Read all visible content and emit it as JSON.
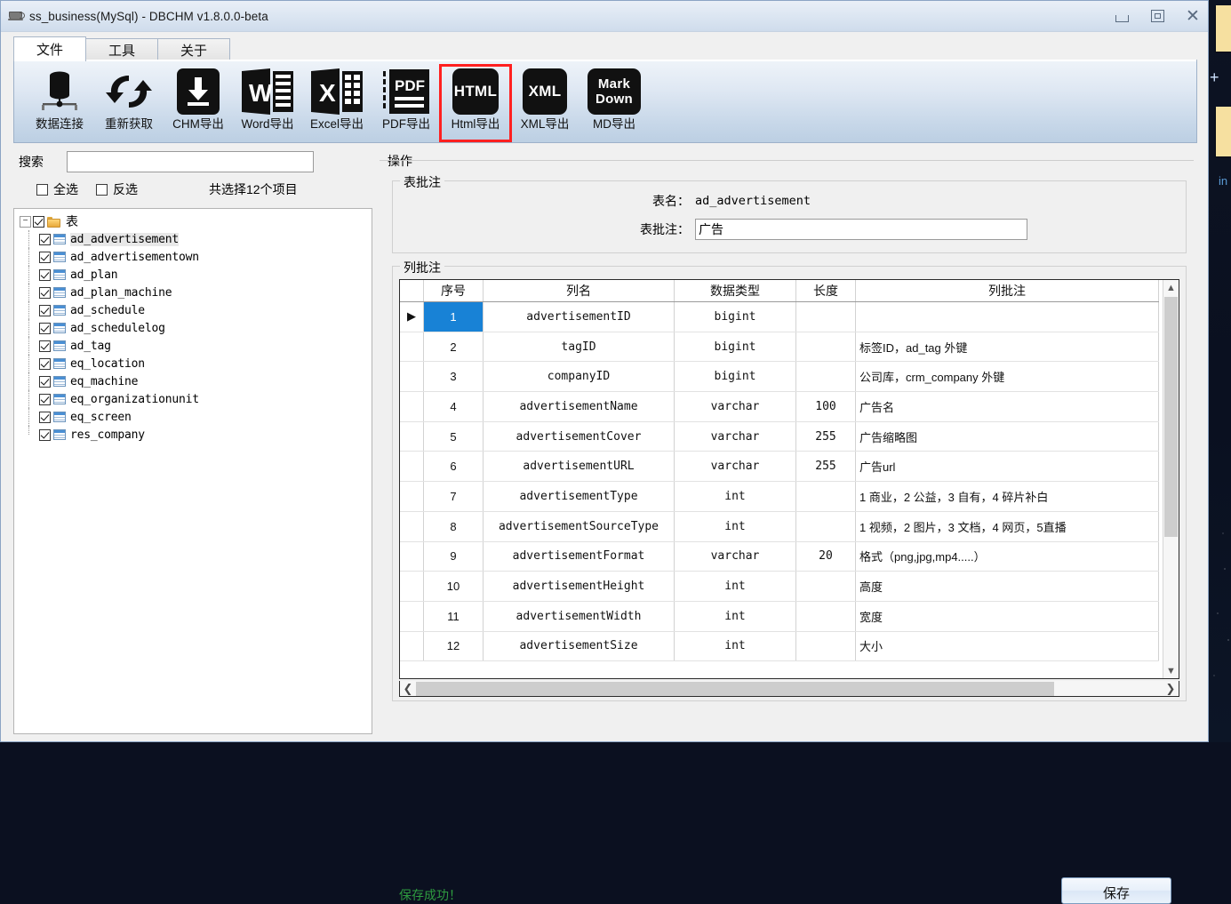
{
  "window": {
    "title": "ss_business(MySql) - DBCHM v1.8.0.0-beta",
    "icon": "database-cup-icon",
    "minimize": "—",
    "maximize": "□",
    "close": "✕"
  },
  "tabs": [
    {
      "label": "文件",
      "active": true
    },
    {
      "label": "工具",
      "active": false
    },
    {
      "label": "关于",
      "active": false
    }
  ],
  "toolbar": {
    "selected": "Html导出",
    "highlight_color": "#ff2020",
    "items": [
      {
        "label": "数据连接",
        "icon": "database-icon",
        "glyph": ""
      },
      {
        "label": "重新获取",
        "icon": "refresh-icon",
        "glyph": ""
      },
      {
        "label": "CHM导出",
        "icon": "chm-download-icon",
        "glyph": ""
      },
      {
        "label": "Word导出",
        "icon": "word-icon",
        "glyph": "W"
      },
      {
        "label": "Excel导出",
        "icon": "excel-icon",
        "glyph": "X"
      },
      {
        "label": "PDF导出",
        "icon": "pdf-icon",
        "glyph": "PDF"
      },
      {
        "label": "Html导出",
        "icon": "html-icon",
        "glyph": "HTML"
      },
      {
        "label": "XML导出",
        "icon": "xml-icon",
        "glyph": "XML"
      },
      {
        "label": "MD导出",
        "icon": "markdown-icon",
        "glyph": "Mark Down"
      }
    ]
  },
  "sidebar": {
    "search_label": "搜索",
    "search_value": "",
    "search_placeholder": "",
    "select_all_label": "全选",
    "select_all_checked": false,
    "invert_label": "反选",
    "invert_checked": false,
    "selected_count_text": "共选择12个项目",
    "root": {
      "label": "表",
      "checked": true,
      "expanded": true
    },
    "tables": [
      {
        "name": "ad_advertisement",
        "checked": true,
        "selected": true
      },
      {
        "name": "ad_advertisementown",
        "checked": true,
        "selected": false
      },
      {
        "name": "ad_plan",
        "checked": true,
        "selected": false
      },
      {
        "name": "ad_plan_machine",
        "checked": true,
        "selected": false
      },
      {
        "name": "ad_schedule",
        "checked": true,
        "selected": false
      },
      {
        "name": "ad_schedulelog",
        "checked": true,
        "selected": false
      },
      {
        "name": "ad_tag",
        "checked": true,
        "selected": false
      },
      {
        "name": "eq_location",
        "checked": true,
        "selected": false
      },
      {
        "name": "eq_machine",
        "checked": true,
        "selected": false
      },
      {
        "name": "eq_organizationunit",
        "checked": true,
        "selected": false
      },
      {
        "name": "eq_screen",
        "checked": true,
        "selected": false
      },
      {
        "name": "res_company",
        "checked": true,
        "selected": false
      }
    ]
  },
  "main": {
    "operations_title": "操作",
    "table_comment_group": {
      "legend": "表批注",
      "table_name_label": "表名：",
      "table_name_value": "ad_advertisement",
      "comment_label": "表批注：",
      "comment_value": "广告"
    },
    "column_comment_group": {
      "legend": "列批注",
      "headers": [
        "",
        "序号",
        "列名",
        "数据类型",
        "长度",
        "列批注"
      ],
      "rows": [
        {
          "marker": "▶",
          "no": "1",
          "name": "advertisementID",
          "type": "bigint",
          "len": "",
          "comment": "",
          "selected": true
        },
        {
          "marker": "",
          "no": "2",
          "name": "tagID",
          "type": "bigint",
          "len": "",
          "comment": "标签ID，ad_tag 外键",
          "selected": false
        },
        {
          "marker": "",
          "no": "3",
          "name": "companyID",
          "type": "bigint",
          "len": "",
          "comment": "公司库，crm_company 外键",
          "selected": false
        },
        {
          "marker": "",
          "no": "4",
          "name": "advertisementName",
          "type": "varchar",
          "len": "100",
          "comment": "广告名",
          "selected": false
        },
        {
          "marker": "",
          "no": "5",
          "name": "advertisementCover",
          "type": "varchar",
          "len": "255",
          "comment": "广告缩略图",
          "selected": false
        },
        {
          "marker": "",
          "no": "6",
          "name": "advertisementURL",
          "type": "varchar",
          "len": "255",
          "comment": "广告url",
          "selected": false
        },
        {
          "marker": "",
          "no": "7",
          "name": "advertisementType",
          "type": "int",
          "len": "",
          "comment": "1 商业，2 公益，3 自有，4 碎片补白",
          "selected": false
        },
        {
          "marker": "",
          "no": "8",
          "name": "advertisementSourceType",
          "type": "int",
          "len": "",
          "comment": "1 视频，2 图片，3 文档，4 网页，5直播",
          "selected": false
        },
        {
          "marker": "",
          "no": "9",
          "name": "advertisementFormat",
          "type": "varchar",
          "len": "20",
          "comment": "格式（png,jpg,mp4.....）",
          "selected": false
        },
        {
          "marker": "",
          "no": "10",
          "name": "advertisementHeight",
          "type": "int",
          "len": "",
          "comment": "高度",
          "selected": false
        },
        {
          "marker": "",
          "no": "11",
          "name": "advertisementWidth",
          "type": "int",
          "len": "",
          "comment": "宽度",
          "selected": false
        },
        {
          "marker": "",
          "no": "12",
          "name": "advertisementSize",
          "type": "int",
          "len": "",
          "comment": "大小",
          "selected": false
        }
      ]
    },
    "save_button": "保存",
    "status_note": "保存成功！",
    "status_color": "#2e9b3f"
  },
  "desktop": {
    "overlay_text": "in"
  }
}
